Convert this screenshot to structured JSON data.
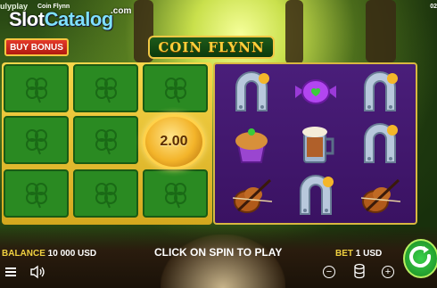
{
  "branding": {
    "provider_small": "ulyplay",
    "slotcatalog_slot": "Slot",
    "slotcatalog_catalog": "Catalog",
    "slotcatalog_com": ".com",
    "game_title_small": "Coin Flynn",
    "clock": "02"
  },
  "header": {
    "buy_bonus_label": "BUY BONUS",
    "game_logo_text": "COIN FLYNN"
  },
  "bonus_grid": {
    "coin_value": "2.00"
  },
  "reels": {
    "symbols": [
      [
        "horseshoe",
        "candy",
        "horseshoe"
      ],
      [
        "cupcake",
        "mug",
        "horseshoe"
      ],
      [
        "violin",
        "horseshoe",
        "violin"
      ]
    ]
  },
  "footer": {
    "balance_label": "BALANCE",
    "balance_value": "10 000 USD",
    "spin_message": "CLICK ON SPIN TO PLAY",
    "bet_label": "BET",
    "bet_value": "1 USD",
    "minus": "−",
    "plus": "+"
  },
  "colors": {
    "tile_green": "#2a8a22",
    "reel_purple": "#4a1e7a",
    "gold": "#f2c744",
    "buy_red": "#d42a1a"
  },
  "icons": [
    "clover-icon",
    "sound-icon",
    "coins-stack-icon",
    "spin-icon"
  ]
}
